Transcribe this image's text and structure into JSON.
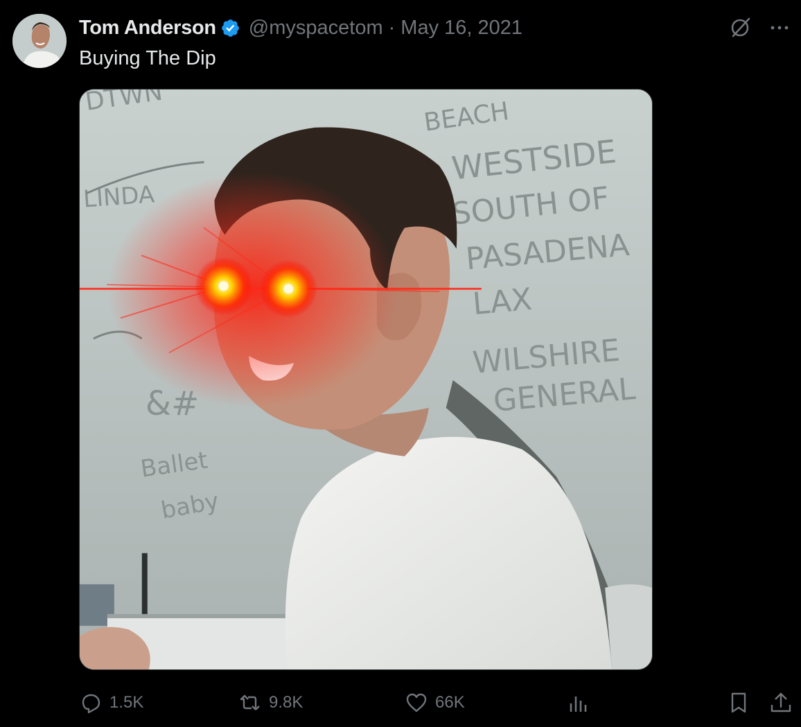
{
  "author": {
    "display_name": "Tom Anderson",
    "handle": "@myspacetom",
    "verified": true,
    "separator": "·",
    "date": "May 16, 2021",
    "avatar_icon": "avatar-photo"
  },
  "tweet": {
    "text": "Buying The Dip"
  },
  "media": {
    "kind": "photo",
    "whiteboard_words": [
      "DTWN",
      "BEACH",
      "WESTSIDE",
      "SOUTH OF",
      "PASADENA",
      "LAX",
      "WILSHIRE",
      "GENERAL",
      "LINDA",
      "&#",
      "Ballet",
      "baby"
    ]
  },
  "actions": {
    "replies": {
      "icon": "reply-icon",
      "count": "1.5K"
    },
    "reposts": {
      "icon": "repost-icon",
      "count": "9.8K"
    },
    "likes": {
      "icon": "heart-icon",
      "count": "66K"
    },
    "views": {
      "icon": "views-icon"
    },
    "bookmark": {
      "icon": "bookmark-icon"
    },
    "share": {
      "icon": "share-icon"
    }
  },
  "top_icons": [
    "grok-icon",
    "more-icon"
  ],
  "colors": {
    "background": "#000000",
    "text_primary": "#e7e9ea",
    "text_secondary": "#71767b",
    "verified_blue": "#1d9bf0",
    "eye_glow": "#ff2a1a"
  }
}
